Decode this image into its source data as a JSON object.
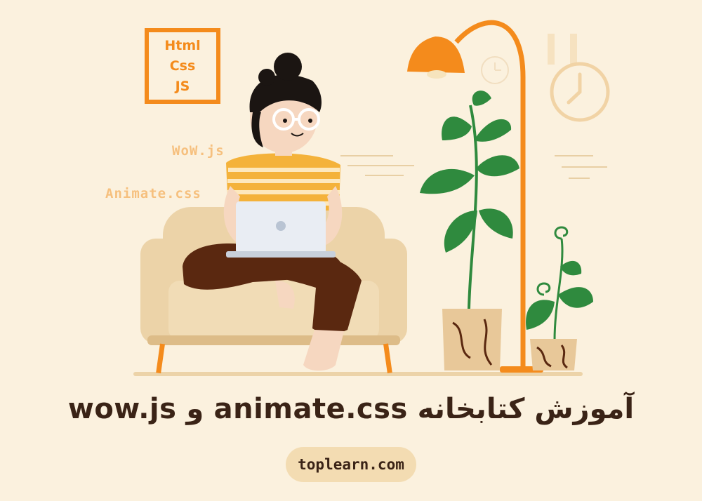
{
  "tech_box": {
    "lines": [
      "Html",
      "Css",
      "JS"
    ]
  },
  "floating_tags": {
    "wow": "WoW.js",
    "animate": "Animate.css"
  },
  "headline": "آموزش کتابخانه animate.css و wow.js",
  "website": "toplearn.com",
  "colors": {
    "background": "#fbf1de",
    "accent_orange": "#f48b1c",
    "light_orange_text": "#f6c07e",
    "dark_text": "#3a2316",
    "pill": "#f3dcb2",
    "sofa": "#ecd3a8",
    "plant_green": "#2f8a3e",
    "pants": "#5a2810"
  },
  "icons": [
    "wall-clock-icon",
    "floor-lamp-icon",
    "laptop-icon",
    "potted-plant-icon"
  ]
}
